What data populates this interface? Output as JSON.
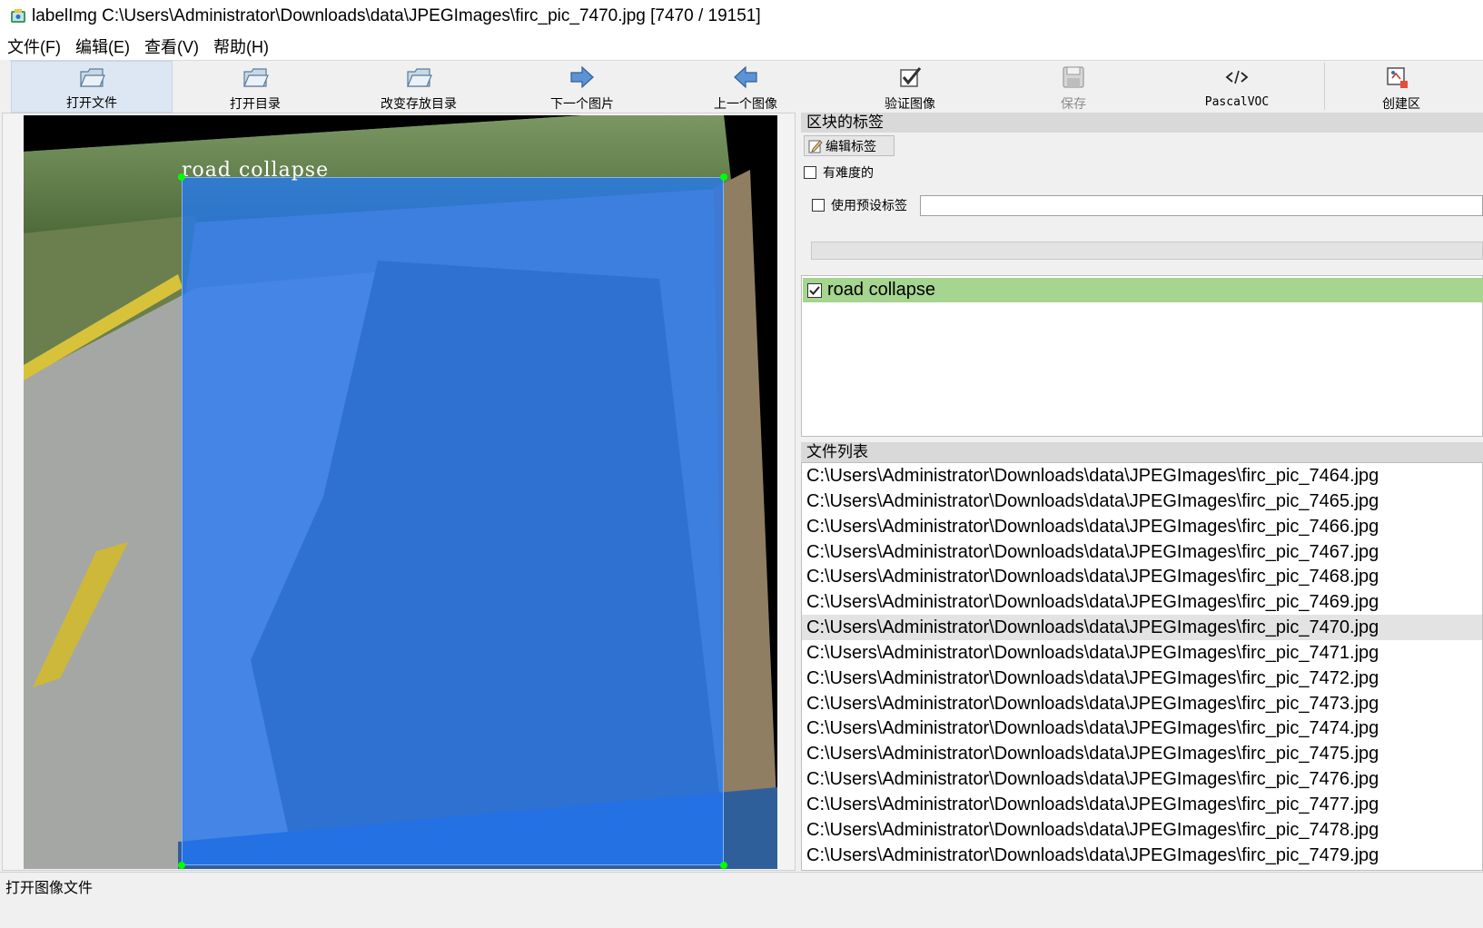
{
  "window": {
    "title": "labelImg C:\\Users\\Administrator\\Downloads\\data\\JPEGImages\\firc_pic_7470.jpg [7470 / 19151]"
  },
  "menu": [
    "文件(F)",
    "编辑(E)",
    "查看(V)",
    "帮助(H)"
  ],
  "toolbar": {
    "open_file": "打开文件",
    "open_dir": "打开目录",
    "change_save_dir": "改变存放目录",
    "next_image": "下一个图片",
    "prev_image": "上一个图像",
    "verify_image": "验证图像",
    "save": "保存",
    "format": "PascalVOC",
    "create_box": "创建区"
  },
  "canvas": {
    "box_label": "road collapse",
    "box_color": "#1e78ff",
    "vertex_color": "#00ff00"
  },
  "labels_panel": {
    "title": "区块的标签",
    "edit_label_button": "编辑标签",
    "difficult_label": "有难度的",
    "use_default_label": "使用预设标签",
    "default_label_value": "",
    "items": [
      {
        "label": "road collapse",
        "checked": true,
        "color": "#a5d58f"
      }
    ]
  },
  "file_panel": {
    "title": "文件列表",
    "files": [
      "C:\\Users\\Administrator\\Downloads\\data\\JPEGImages\\firc_pic_7464.jpg",
      "C:\\Users\\Administrator\\Downloads\\data\\JPEGImages\\firc_pic_7465.jpg",
      "C:\\Users\\Administrator\\Downloads\\data\\JPEGImages\\firc_pic_7466.jpg",
      "C:\\Users\\Administrator\\Downloads\\data\\JPEGImages\\firc_pic_7467.jpg",
      "C:\\Users\\Administrator\\Downloads\\data\\JPEGImages\\firc_pic_7468.jpg",
      "C:\\Users\\Administrator\\Downloads\\data\\JPEGImages\\firc_pic_7469.jpg",
      "C:\\Users\\Administrator\\Downloads\\data\\JPEGImages\\firc_pic_7470.jpg",
      "C:\\Users\\Administrator\\Downloads\\data\\JPEGImages\\firc_pic_7471.jpg",
      "C:\\Users\\Administrator\\Downloads\\data\\JPEGImages\\firc_pic_7472.jpg",
      "C:\\Users\\Administrator\\Downloads\\data\\JPEGImages\\firc_pic_7473.jpg",
      "C:\\Users\\Administrator\\Downloads\\data\\JPEGImages\\firc_pic_7474.jpg",
      "C:\\Users\\Administrator\\Downloads\\data\\JPEGImages\\firc_pic_7475.jpg",
      "C:\\Users\\Administrator\\Downloads\\data\\JPEGImages\\firc_pic_7476.jpg",
      "C:\\Users\\Administrator\\Downloads\\data\\JPEGImages\\firc_pic_7477.jpg",
      "C:\\Users\\Administrator\\Downloads\\data\\JPEGImages\\firc_pic_7478.jpg",
      "C:\\Users\\Administrator\\Downloads\\data\\JPEGImages\\firc_pic_7479.jpg"
    ],
    "selected": "C:\\Users\\Administrator\\Downloads\\data\\JPEGImages\\firc_pic_7470.jpg"
  },
  "status": {
    "text": "打开图像文件"
  }
}
